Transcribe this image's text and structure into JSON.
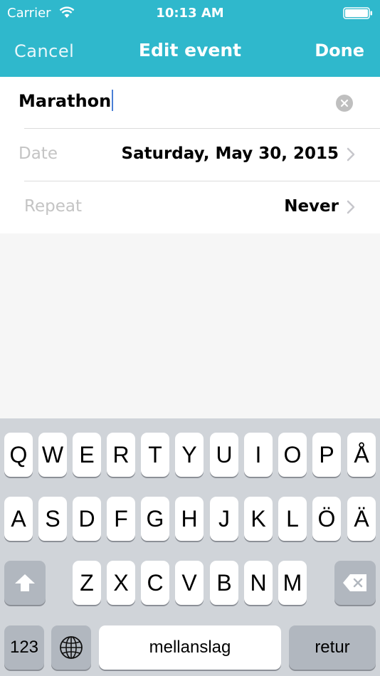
{
  "colors": {
    "accent": "#2fb8cc",
    "background": "#f6f6f6",
    "label_gray": "#c4c4c4",
    "keyboard_bg": "#d0d4d9"
  },
  "status_bar": {
    "carrier": "Carrier",
    "time": "10:13 AM",
    "wifi_icon": "wifi-icon",
    "battery_icon": "battery-icon"
  },
  "nav": {
    "cancel_label": "Cancel",
    "title": "Edit event",
    "done_label": "Done"
  },
  "form": {
    "title_value": "Marathon",
    "date_label": "Date",
    "date_value": "Saturday, May 30, 2015",
    "repeat_label": "Repeat",
    "repeat_value": "Never"
  },
  "keyboard": {
    "row1": [
      "Q",
      "W",
      "E",
      "R",
      "T",
      "Y",
      "U",
      "I",
      "O",
      "P",
      "Å"
    ],
    "row2": [
      "A",
      "S",
      "D",
      "F",
      "G",
      "H",
      "J",
      "K",
      "L",
      "Ö",
      "Ä"
    ],
    "row3": [
      "Z",
      "X",
      "C",
      "V",
      "B",
      "N",
      "M"
    ],
    "numbers_label": "123",
    "space_label": "mellanslag",
    "return_label": "retur",
    "shift_icon": "shift-icon",
    "globe_icon": "globe-icon",
    "delete_icon": "backspace-icon"
  }
}
